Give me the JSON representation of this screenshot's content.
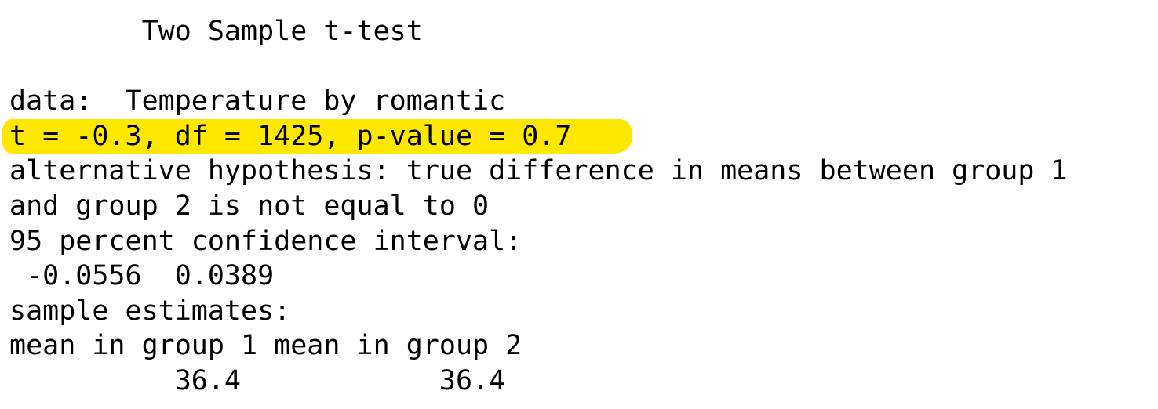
{
  "output": {
    "title": "        Two Sample t-test",
    "data_line": "data:  Temperature by romantic",
    "stats_line": "t = -0.3, df = 1425, p-value = 0.7",
    "alternative_line1": "alternative hypothesis: true difference in means between group 1",
    "alternative_line2": "and group 2 is not equal to 0",
    "ci_label": "95 percent confidence interval:",
    "ci_values": " -0.0556  0.0389",
    "estimates_label": "sample estimates:",
    "estimates_header": "mean in group 1 mean in group 2",
    "estimates_values": "          36.4            36.4"
  },
  "colors": {
    "highlight": "#ffe800",
    "text": "#000000",
    "background": "#ffffff"
  }
}
